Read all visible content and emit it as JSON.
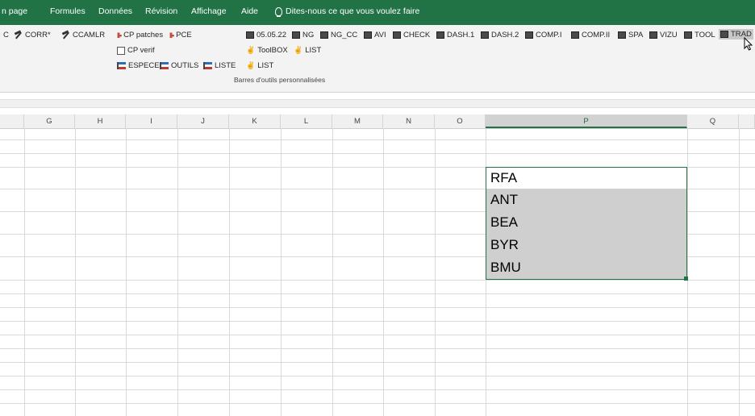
{
  "menu": {
    "items": [
      "n page",
      "Formules",
      "Données",
      "Révision",
      "Affichage",
      "Aide"
    ],
    "tell_me": "Dites-nous ce que vous voulez faire"
  },
  "ribbon": {
    "left_buttons": [
      "C",
      "CORR*",
      "CCAMLR"
    ],
    "col2": [
      "CP patches",
      "PCE",
      "CP verif",
      "ESPECE",
      "OUTILS",
      "LISTE"
    ],
    "col3": [
      "ToolBOX",
      "LIST",
      "LIST"
    ],
    "toolbar_buttons": [
      "05.05.22",
      "NG",
      "NG_CC",
      "AVI",
      "CHECK",
      "DASH.1",
      "DASH.2",
      "COMP.I",
      "COMP.II",
      "SPA",
      "VIZU",
      "TOOL",
      "TRAD"
    ],
    "group_label": "Barres d'outils personnalisées"
  },
  "columns": [
    "G",
    "H",
    "I",
    "J",
    "K",
    "L",
    "M",
    "N",
    "O",
    "P",
    "Q"
  ],
  "selected_column": "P",
  "cells": [
    "RFA",
    "ANT",
    "BEA",
    "BYR",
    "BMU"
  ],
  "colors": {
    "accent": "#217346",
    "selection_fill": "#cfcfcf"
  }
}
